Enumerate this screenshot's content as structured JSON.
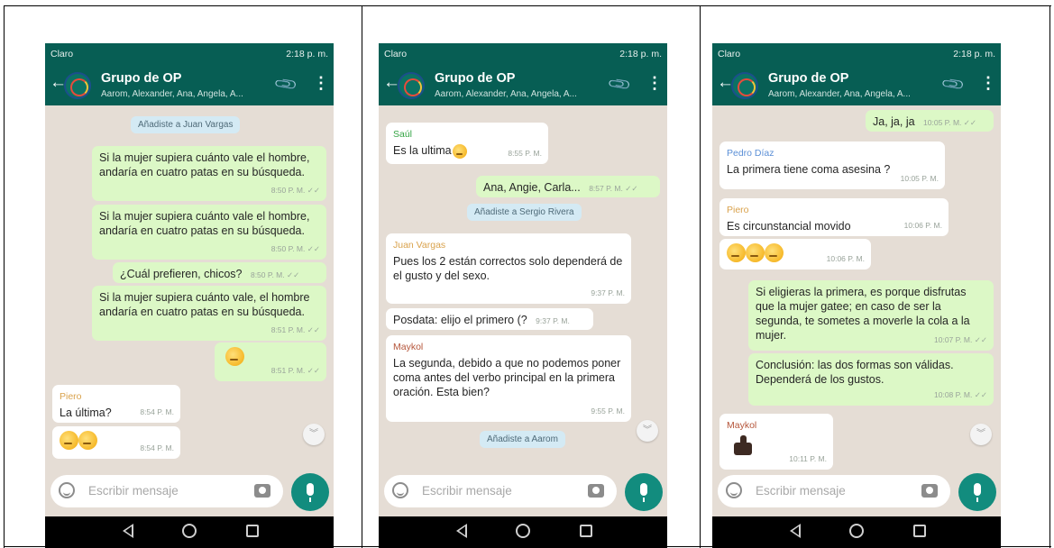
{
  "status": {
    "carrier": "Claro",
    "time": "2:18 p. m."
  },
  "chat": {
    "title": "Grupo de OP",
    "subtitle": "Aarom, Alexander, Ana, Angela, A...",
    "placeholder": "Escribir mensaje"
  },
  "icons": {
    "back": "arrow-left",
    "attach": "paperclip",
    "menu": "more-vertical",
    "emoji": "smiley",
    "camera": "camera",
    "mic": "microphone",
    "scroll": "double-chevron-down"
  },
  "colors": {
    "header": "#075e54",
    "outgoing": "#dcf8c6",
    "incoming": "#ffffff",
    "accent": "#128c7e"
  },
  "screen1": {
    "sys1": "Añadiste a Juan Vargas",
    "m1_text": "Si la mujer supiera cuánto vale el hombre, andaría en cuatro patas en su búsqueda.",
    "m1_time": "8:50 P. M.",
    "m2_text": "Si la mujer supiera cuánto vale el hombre, andaría en cuatro patas en su búsqueda.",
    "m2_time": "8:50 P. M.",
    "m3_text": "¿Cuál prefieren, chicos?",
    "m3_time": "8:50 P. M.",
    "m4_text": "Si la mujer supiera cuánto vale, el hombre andaría en cuatro patas en su búsqueda.",
    "m4_time": "8:51 P. M.",
    "m5_time": "8:51 P. M.",
    "m6_sender": "Piero",
    "m6_text": "La última?",
    "m6_time": "8:54 P. M.",
    "m7_time": "8:54 P. M."
  },
  "screen2": {
    "m1_sender": "Saúl",
    "m1_text": "Es la ultima",
    "m1_time": "8:55 P. M.",
    "m2_text": "Ana, Angie, Carla...",
    "m2_time": "8:57 P. M.",
    "sys1": "Añadiste a Sergio Rivera",
    "m3_sender": "Juan Vargas",
    "m3_text": "Pues los 2 están correctos solo dependerá de el gusto y del sexo.",
    "m3_time": "9:37 P. M.",
    "m4_text": "Posdata: elijo el primero (?",
    "m4_time": "9:37 P. M.",
    "m5_sender": "Maykol",
    "m5_text": "La segunda, debido a que no podemos poner coma antes del verbo principal en la primera oración. Esta bien?",
    "m5_time": "9:55 P. M.",
    "sys2": "Añadiste a Aarom"
  },
  "screen3": {
    "m1_text": "Ja, ja, ja",
    "m1_time": "10:05 P. M.",
    "m2_sender": "Pedro Díaz",
    "m2_text": "La primera tiene coma asesina ?",
    "m2_time": "10:05 P. M.",
    "m3_sender": "Piero",
    "m3_text": "Es circunstancial movido",
    "m3_time": "10:06 P. M.",
    "m4_time": "10:06 P. M.",
    "m5_text": "Si eligieras la primera, es porque disfrutas que la mujer gatee; en caso de ser la segunda, te sometes a moverle la cola a la mujer.",
    "m5_time": "10:07 P. M.",
    "m6_text": "Conclusión: las dos formas son válidas. Dependerá de los gustos.",
    "m6_time": "10:08 P. M.",
    "m7_sender": "Maykol",
    "m7_time": "10:11 P. M."
  }
}
